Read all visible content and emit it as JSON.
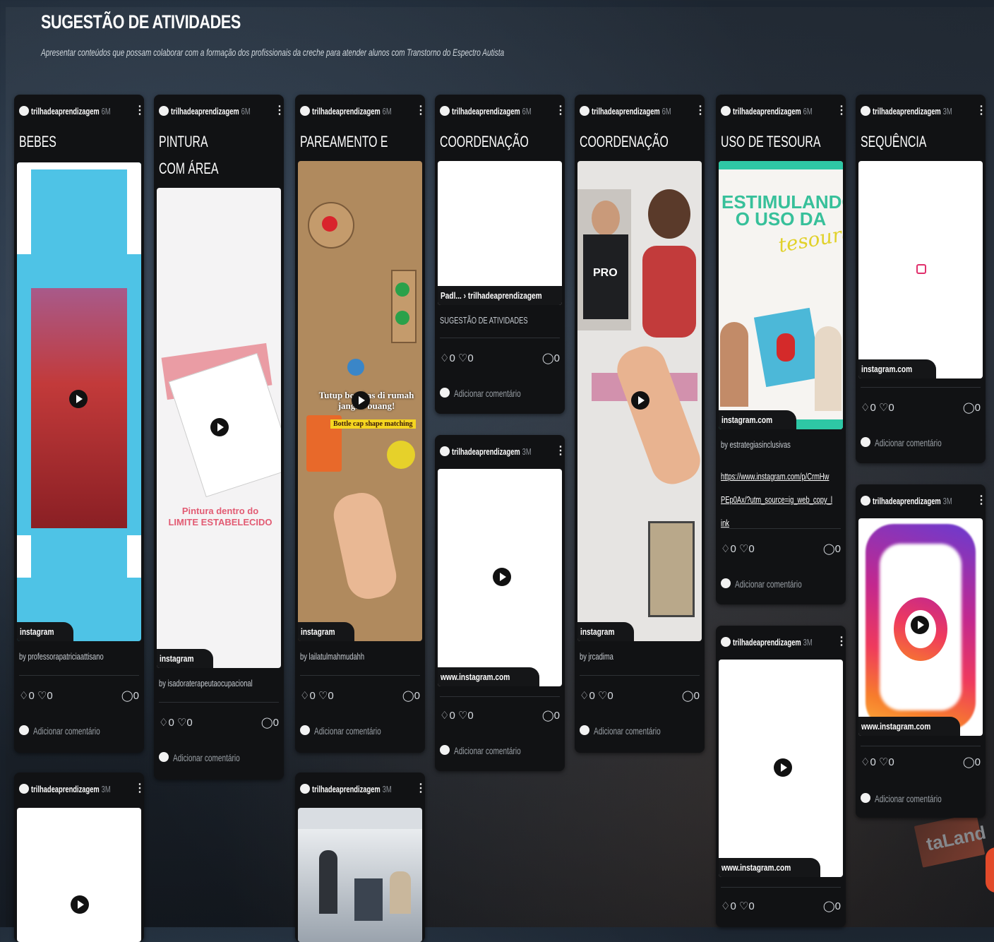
{
  "board": {
    "title": "SUGESTÃO DE ATIVIDADES",
    "description": "Apresentar conteúdos que possam colaborar com a formação dos profissionais da creche para atender alunos com Transtorno do Espectro Autista"
  },
  "comment_placeholder": "Adicionar comentário",
  "author": "trilhadeaprendizagem",
  "cards": [
    {
      "age": "6M",
      "title": "BEBES",
      "source": "instagram",
      "by": "by professorapatriciaattisano",
      "reactions": {
        "likes": "0",
        "dislikes": "0",
        "comments": "0"
      }
    },
    {
      "age": "3M",
      "title": "",
      "source": "",
      "by": "",
      "reactions": {
        "likes": "0",
        "dislikes": "0",
        "comments": "0"
      }
    },
    {
      "age": "6M",
      "title": "PINTURA COM ÁREA LIMITADA",
      "source": "instagram",
      "by": "by isadoraterapeutaocupacional",
      "image_text": [
        "Pintura dentro do",
        "LIMITE ESTABELECIDO"
      ],
      "reactions": {
        "likes": "0",
        "dislikes": "0",
        "comments": "0"
      }
    },
    {
      "age": "6M",
      "title": "PAREAMENTO E CORES",
      "source": "instagram",
      "by": "by lailatulmahmudahh",
      "image_text": [
        "Tutup botol",
        "as di rumah",
        "jangan",
        "buang!",
        "Bottle cap shape matching"
      ],
      "reactions": {
        "likes": "0",
        "dislikes": "0",
        "comments": "0"
      }
    },
    {
      "age": "3M",
      "title": "",
      "source": "",
      "by": "",
      "reactions": {
        "likes": "0",
        "dislikes": "0",
        "comments": "0"
      }
    },
    {
      "age": "6M",
      "title": "COORDENAÇÃO MOTORA",
      "source": "Padl... › trilhadeaprendizagem",
      "by": "SUGESTÃO DE ATIVIDADES",
      "reactions": {
        "likes": "0",
        "dislikes": "0",
        "comments": "0"
      }
    },
    {
      "age": "3M",
      "title": "",
      "source": "www.instagram.com",
      "by": "",
      "reactions": {
        "likes": "0",
        "dislikes": "0",
        "comments": "0"
      }
    },
    {
      "age": "6M",
      "title": "COORDENAÇÃO MOTORA",
      "source": "instagram",
      "by": "by jrcadima",
      "image_text": [
        "PRO"
      ],
      "reactions": {
        "likes": "0",
        "dislikes": "0",
        "comments": "0"
      }
    },
    {
      "age": "6M",
      "title": "USO DE TESOURA",
      "source": "instagram.com",
      "by": "by estrategiasinclusivas",
      "link": "https://www.instagram.com/p/CrmHwPEp0Ax/?utm_source=ig_web_copy_link",
      "image_text": [
        "ESTIMULANDO",
        "O USO DA",
        "tesoura"
      ],
      "reactions": {
        "likes": "0",
        "dislikes": "0",
        "comments": "0"
      }
    },
    {
      "age": "3M",
      "title": "",
      "source": "www.instagram.com",
      "by": "",
      "reactions": {
        "likes": "0",
        "dislikes": "0",
        "comments": "0"
      }
    },
    {
      "age": "3M",
      "title": "SEQUÊNCIA",
      "source": "instagram.com",
      "by": "",
      "reactions": {
        "likes": "0",
        "dislikes": "0",
        "comments": "0"
      }
    },
    {
      "age": "3M",
      "title": "",
      "source": "www.instagram.com",
      "by": "",
      "reactions": {
        "likes": "0",
        "dislikes": "0",
        "comments": "0"
      }
    }
  ],
  "background_text": "taLand",
  "colors": {
    "card_bg": "#111214",
    "accent_fab": "#e24a2a",
    "cyan": "#4ec3e6",
    "instagram_pink": "#e1306c"
  }
}
